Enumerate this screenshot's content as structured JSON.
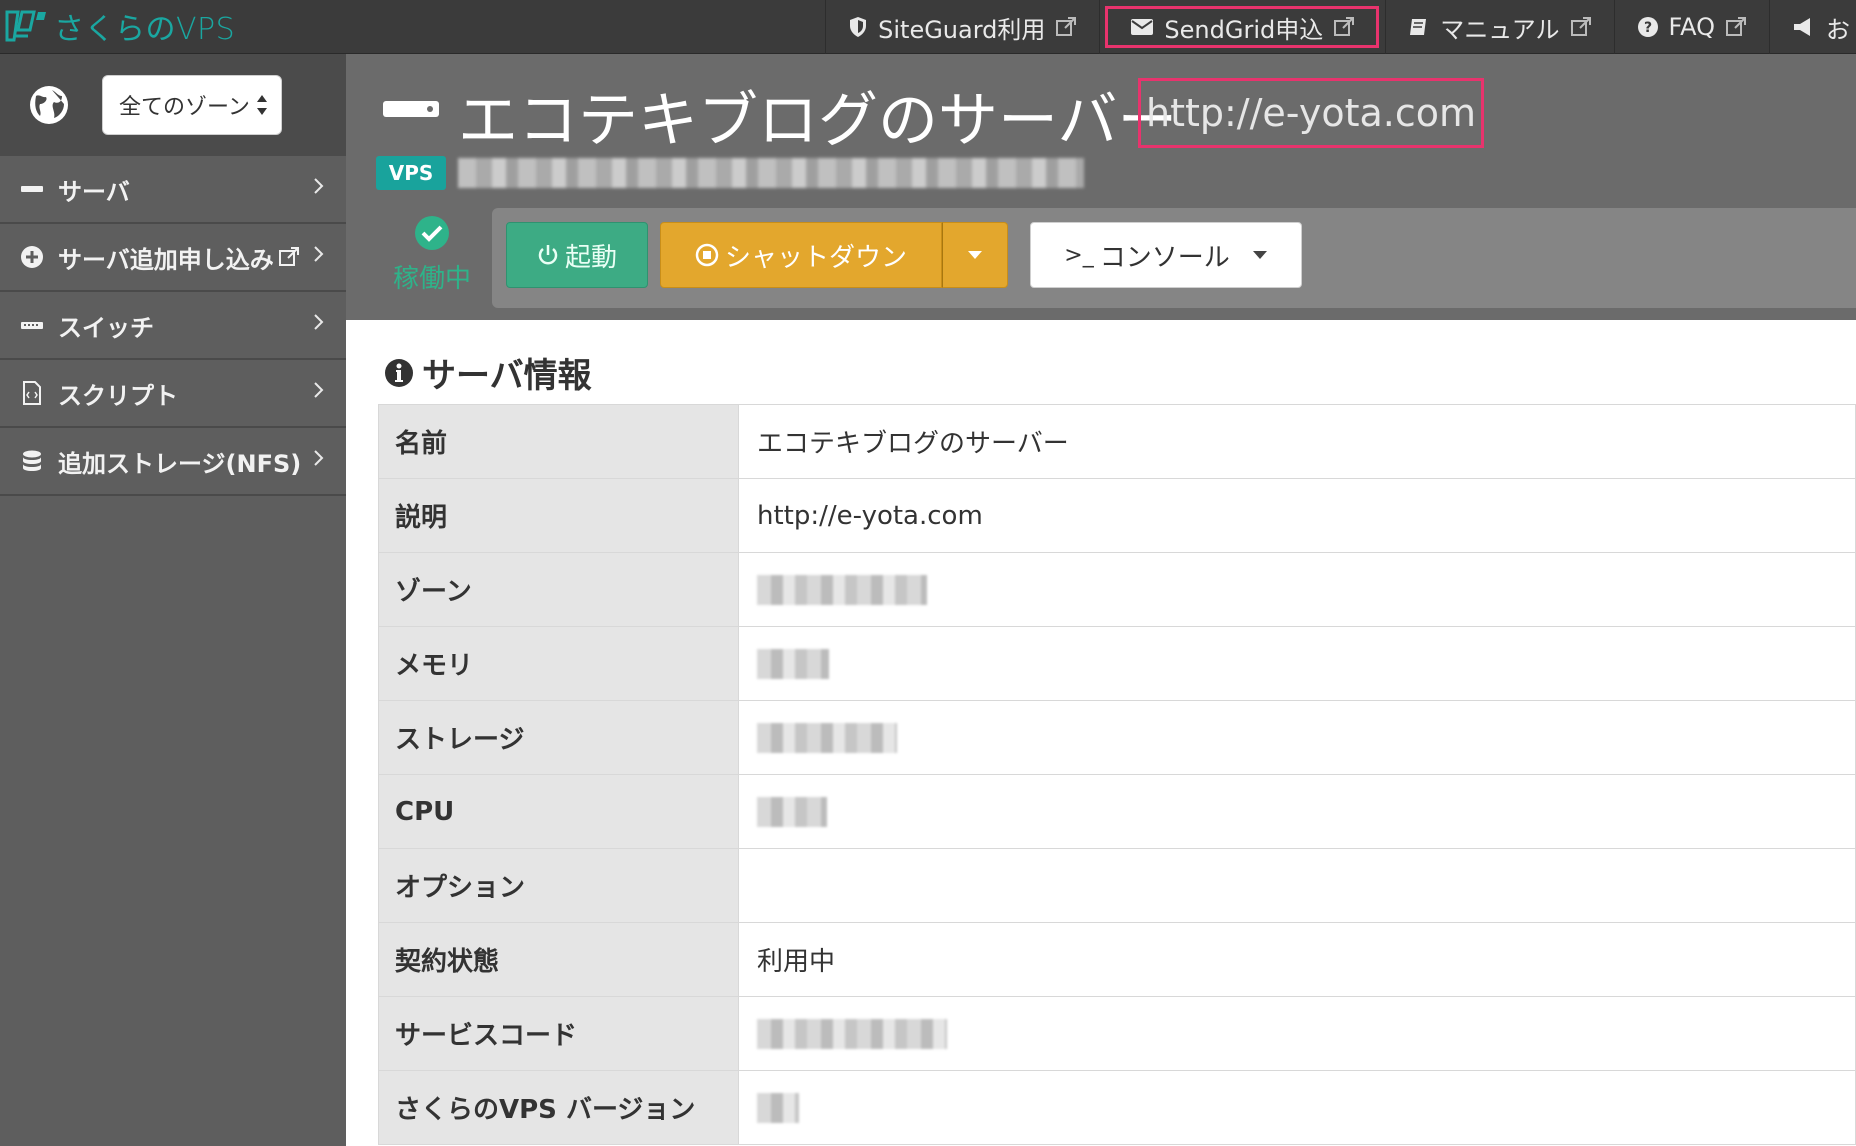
{
  "app": {
    "logo_text": "さくらのVPS",
    "brand_color": "#1aa7a1",
    "highlight_color": "#e8336d"
  },
  "topnav": {
    "items": [
      {
        "label": "SiteGuard利用",
        "icon": "shield-icon",
        "external": true
      },
      {
        "label": "SendGrid申込",
        "icon": "envelope-icon",
        "external": true,
        "highlighted": true
      },
      {
        "label": "マニュアル",
        "icon": "book-icon",
        "external": true
      },
      {
        "label": "FAQ",
        "icon": "question-circle-icon",
        "external": true
      },
      {
        "label": "お",
        "icon": "megaphone-icon",
        "external": false
      }
    ]
  },
  "sidebar": {
    "zone_select": {
      "value": "全てのゾーン"
    },
    "items": [
      {
        "label": "サーバ",
        "icon": "server-icon"
      },
      {
        "label": "サーバ追加申し込み",
        "icon": "plus-circle-icon",
        "external": true
      },
      {
        "label": "スイッチ",
        "icon": "switch-icon"
      },
      {
        "label": "スクリプト",
        "icon": "script-file-icon"
      },
      {
        "label": "追加ストレージ(NFS)",
        "icon": "database-icon"
      }
    ]
  },
  "header": {
    "title": "エコテキブログのサーバー",
    "url": "http://e-yota.com",
    "badge": "VPS",
    "status": "稼働中",
    "status_color": "#2eb38a"
  },
  "actions": {
    "start": "起動",
    "shutdown": "シャットダウン",
    "console": "コンソール",
    "console_prefix": ">_"
  },
  "info": {
    "title": "サーバ情報",
    "rows": [
      {
        "label": "名前",
        "value": "エコテキブログのサーバー"
      },
      {
        "label": "説明",
        "value": "http://e-yota.com"
      },
      {
        "label": "ゾーン",
        "value": ""
      },
      {
        "label": "メモリ",
        "value": ""
      },
      {
        "label": "ストレージ",
        "value": ""
      },
      {
        "label": "CPU",
        "value": ""
      },
      {
        "label": "オプション",
        "value": ""
      },
      {
        "label": "契約状態",
        "value": "利用中"
      },
      {
        "label": "サービスコード",
        "value": ""
      },
      {
        "label": "さくらのVPS バージョン",
        "value": ""
      }
    ]
  }
}
